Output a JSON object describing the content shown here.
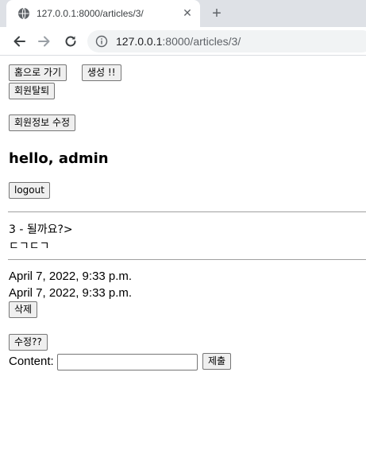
{
  "browser": {
    "tab_title": "127.0.0.1:8000/articles/3/",
    "close_glyph": "✕",
    "new_tab_glyph": "+",
    "url_host": "127.0.0.1",
    "url_path": ":8000/articles/3/",
    "icons": [
      "globe-icon",
      "close-icon",
      "plus-icon",
      "back-arrow-icon",
      "forward-arrow-icon",
      "reload-icon",
      "info-icon"
    ]
  },
  "nav": {
    "home_label": "홈으로 가기",
    "create_label": "생성 !!",
    "withdraw_label": "회원탈퇴",
    "edit_profile_label": "회원정보 수정"
  },
  "user": {
    "greeting": "hello, admin",
    "logout_label": "logout"
  },
  "article": {
    "title_line": "3 - 될까요?>",
    "body_line": "ㄷㄱㄷㄱ",
    "created_at": "April 7, 2022, 9:33 p.m.",
    "updated_at": "April 7, 2022, 9:33 p.m.",
    "delete_label": "삭제",
    "edit_label": "수정??"
  },
  "comment": {
    "label": "Content:",
    "value": "",
    "submit_label": "제출"
  },
  "colors": {
    "tabstrip": "#dee1e6",
    "omnibox": "#f1f3f4",
    "icon": "#5f6368",
    "button_bg": "#efefef",
    "button_border": "#767676"
  }
}
